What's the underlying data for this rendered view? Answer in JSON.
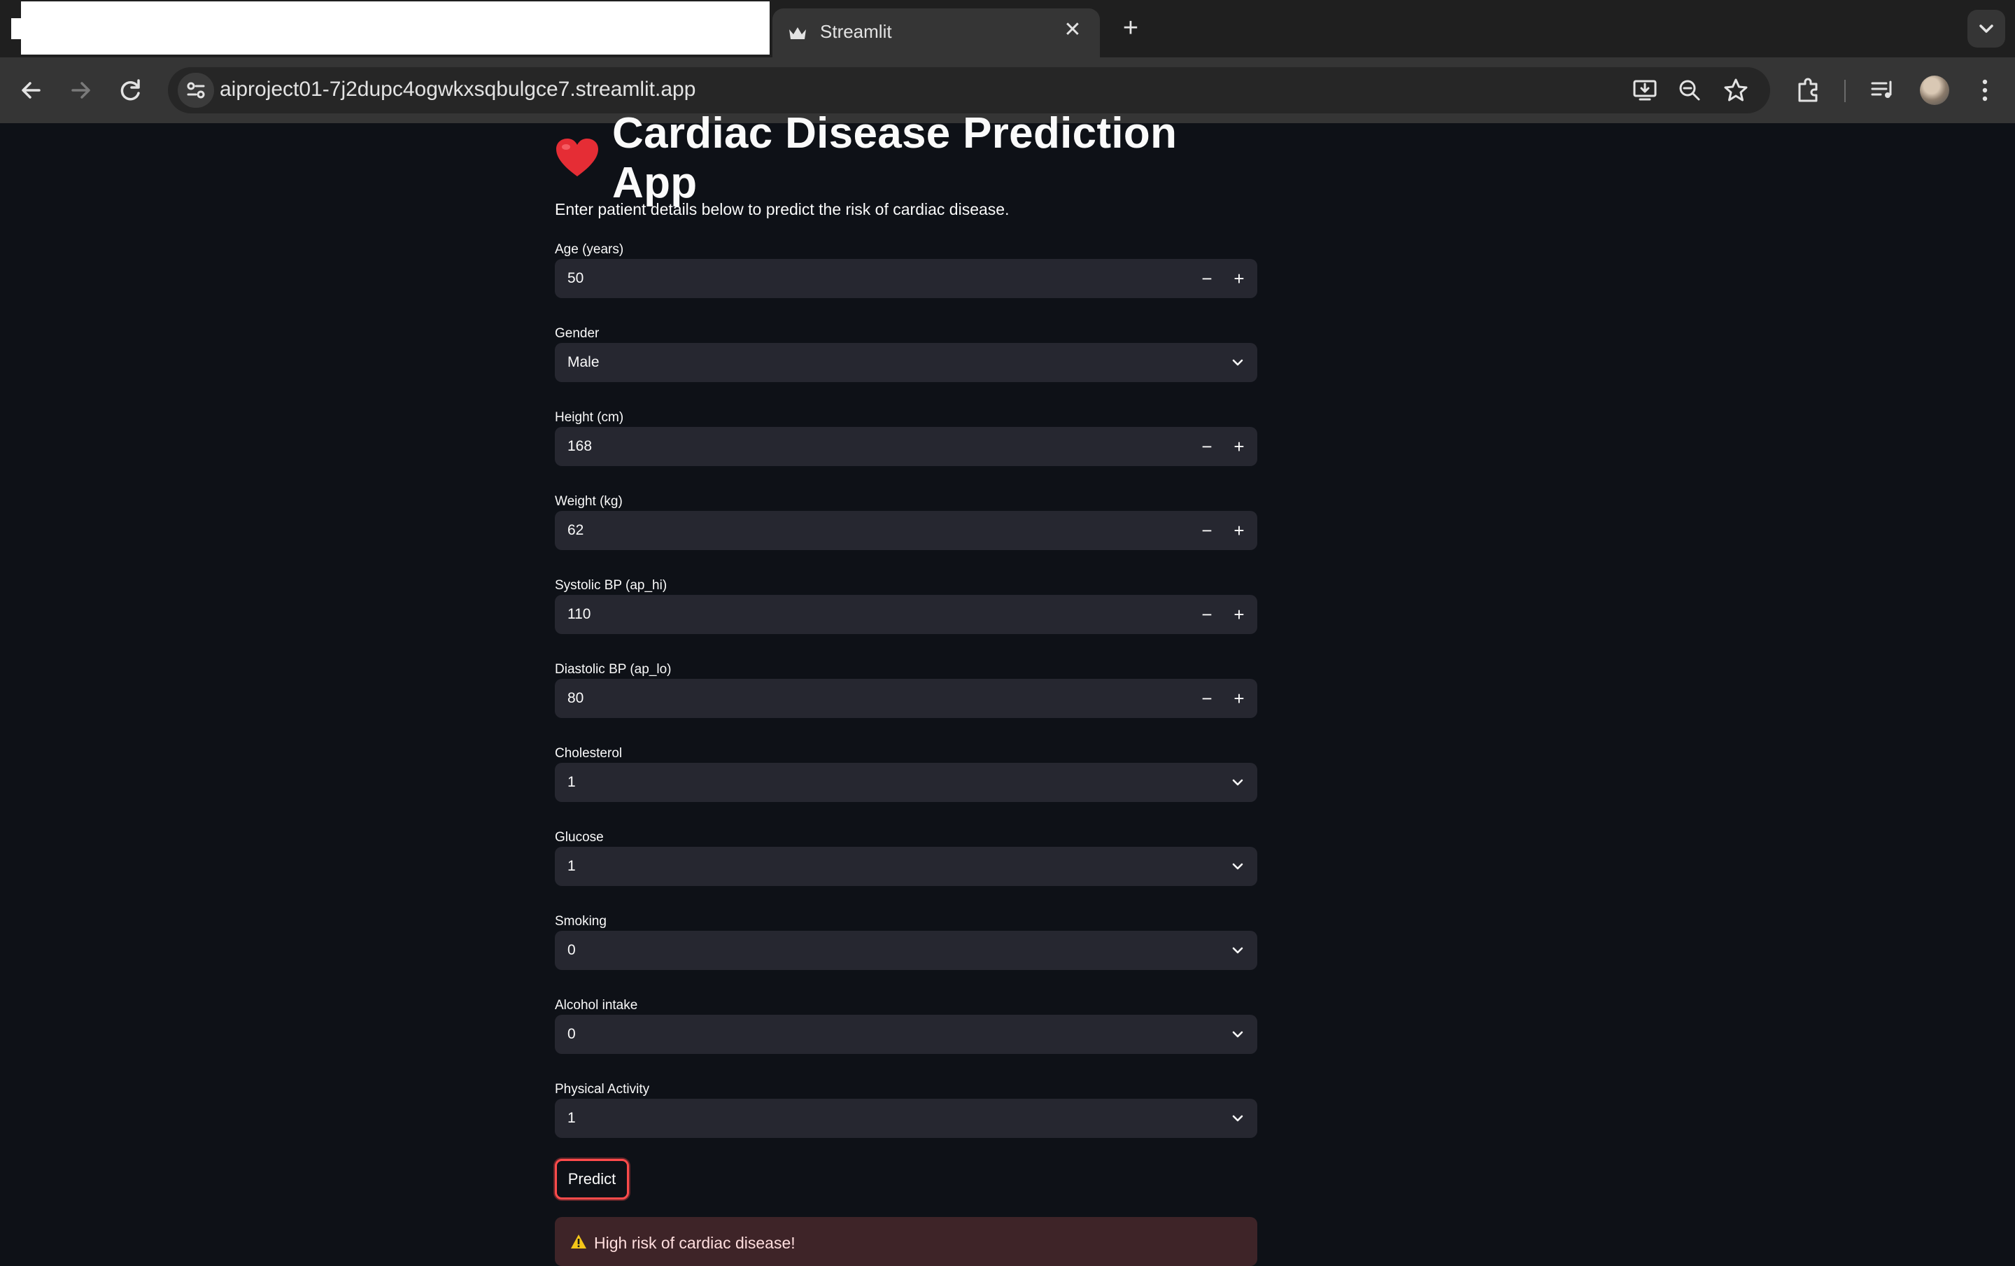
{
  "browser": {
    "tab_title": "Streamlit",
    "tab_favicon": "crown-icon",
    "url": "aiproject01-7j2dupc4ogwkxsqbulgce7.streamlit.app",
    "icons": [
      "back-icon",
      "forward-icon",
      "reload-icon",
      "site-info-icon",
      "install-app-icon",
      "zoom-icon",
      "bookmark-star-icon",
      "extensions-icon",
      "media-controls-icon",
      "profile-avatar",
      "more-menu-icon"
    ]
  },
  "app": {
    "title": "Cardiac Disease Prediction App",
    "title_icon": "heart-icon",
    "subtitle": "Enter patient details below to predict the risk of cardiac disease.",
    "fields": [
      {
        "label": "Age (years)",
        "type": "number",
        "value": "50"
      },
      {
        "label": "Gender",
        "type": "select",
        "value": "Male"
      },
      {
        "label": "Height (cm)",
        "type": "number",
        "value": "168"
      },
      {
        "label": "Weight (kg)",
        "type": "number",
        "value": "62"
      },
      {
        "label": "Systolic BP (ap_hi)",
        "type": "number",
        "value": "110"
      },
      {
        "label": "Diastolic BP (ap_lo)",
        "type": "number",
        "value": "80"
      },
      {
        "label": "Cholesterol",
        "type": "select",
        "value": "1"
      },
      {
        "label": "Glucose",
        "type": "select",
        "value": "1"
      },
      {
        "label": "Smoking",
        "type": "select",
        "value": "0"
      },
      {
        "label": "Alcohol intake",
        "type": "select",
        "value": "0"
      },
      {
        "label": "Physical Activity",
        "type": "select",
        "value": "1"
      }
    ],
    "stepper": {
      "minus": "−",
      "plus": "+"
    },
    "predict_label": "Predict",
    "result_text": "High risk of cardiac disease!",
    "result_icon": "warning-icon"
  },
  "colors": {
    "background": "#0e1117",
    "input_bg": "#262730",
    "accent": "#ff4b4b",
    "error_bg": "#3e2428"
  }
}
